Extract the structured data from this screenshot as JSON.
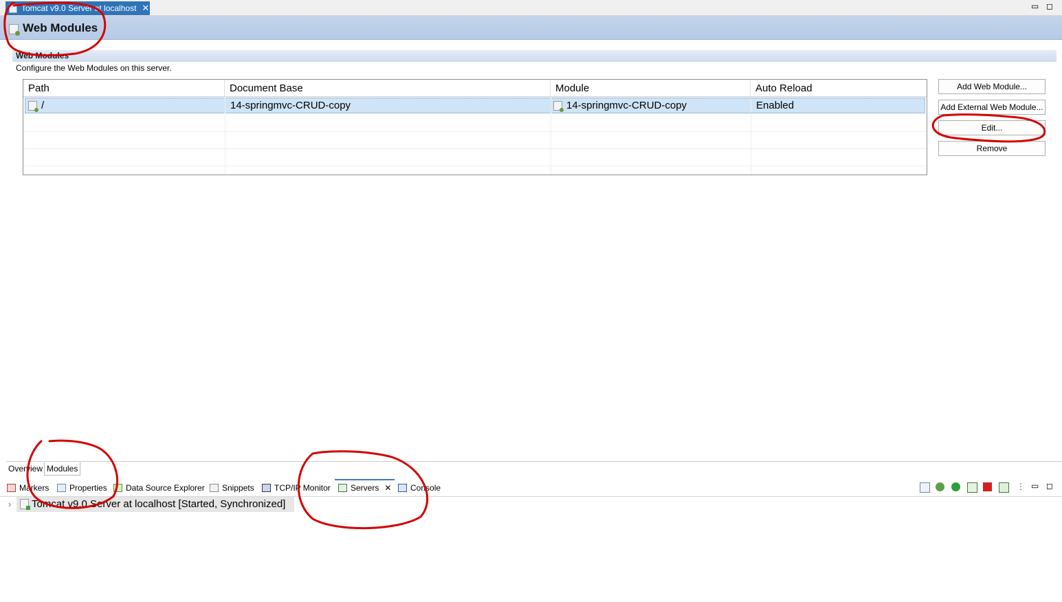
{
  "editor": {
    "tab_title": "Tomcat v9.0 Server at localhost",
    "close_glyph": "✕",
    "minimize_glyph": "▭",
    "maximize_glyph": "◻"
  },
  "header": {
    "title": "Web Modules"
  },
  "section": {
    "title": "Web Modules",
    "description": "Configure the Web Modules on this server."
  },
  "table": {
    "columns": [
      "Path",
      "Document Base",
      "Module",
      "Auto Reload"
    ],
    "rows": [
      {
        "path": "/",
        "document_base": "14-springmvc-CRUD-copy",
        "module": "14-springmvc-CRUD-copy",
        "auto_reload": "Enabled"
      }
    ]
  },
  "buttons": {
    "add_web_module": "Add Web Module...",
    "add_external_web_module": "Add External Web Module...",
    "edit": "Edit...",
    "remove": "Remove"
  },
  "page_tabs": [
    "Overview",
    "Modules"
  ],
  "views": {
    "tabs": [
      "Markers",
      "Properties",
      "Data Source Explorer",
      "Snippets",
      "TCP/IP Monitor",
      "Servers",
      "Console"
    ],
    "servers_close_glyph": "✕",
    "view_menu_glyph": "⋮"
  },
  "servers": {
    "expand_glyph": "›",
    "entry": "Tomcat v9.0 Server at localhost  [Started, Synchronized]"
  },
  "annotation_color": "#d40000"
}
